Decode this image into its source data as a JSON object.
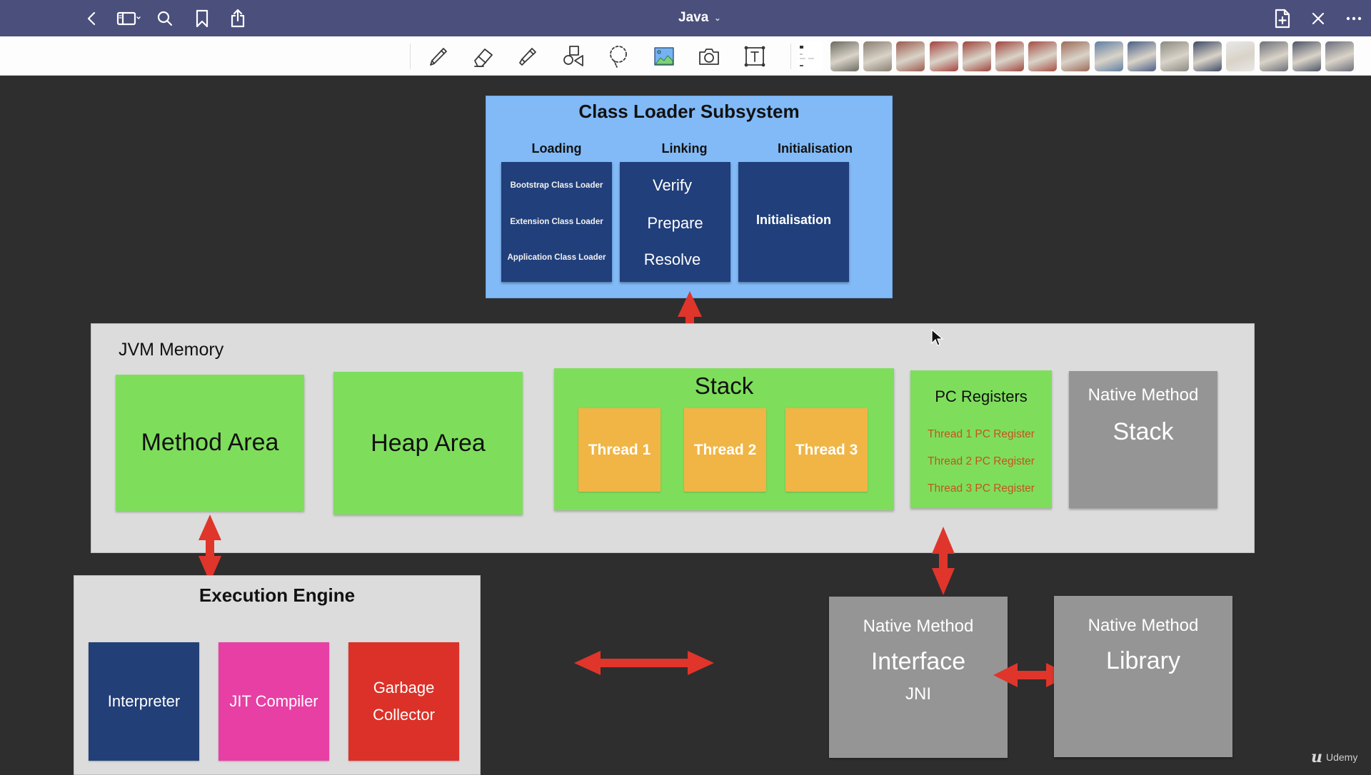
{
  "titlebar": {
    "title": "Java",
    "title_chevron": "⌄",
    "left_icons": [
      "back-icon",
      "sidebar-toggle-icon",
      "search-icon",
      "bookmark-icon",
      "share-icon"
    ],
    "right_icons": [
      "add-page-icon",
      "close-icon",
      "more-icon"
    ]
  },
  "toolbar": {
    "tools": [
      "pen-tool",
      "eraser-tool",
      "highlighter-tool",
      "shapes-tool",
      "lasso-tool",
      "image-tool",
      "camera-tool",
      "text-tool"
    ],
    "thumbnails_count": 16,
    "thumbnail_colors": [
      "#6b6a62",
      "#8a7f72",
      "#9b5a4e",
      "#a4423c",
      "#9e453d",
      "#a0463e",
      "#a54e44",
      "#9c6a58",
      "#5f7fa3",
      "#4a5f86",
      "#8b8a82",
      "#3e4a66",
      "#e8e8e8",
      "#6c6f78",
      "#4c5366",
      "#6b6e7c"
    ]
  },
  "diagram": {
    "class_loader": {
      "title": "Class Loader Subsystem",
      "columns": [
        {
          "label": "Loading",
          "items": [
            "Bootstrap Class Loader",
            "Extension Class Loader",
            "Application Class Loader"
          ]
        },
        {
          "label": "Linking",
          "items": [
            "Verify",
            "Prepare",
            "Resolve"
          ]
        },
        {
          "label": "Initialisation",
          "items": [
            "Initialisation"
          ]
        }
      ]
    },
    "jvm_memory": {
      "label": "JVM Memory",
      "method_area": "Method Area",
      "heap_area": "Heap Area",
      "stack": {
        "title": "Stack",
        "threads": [
          "Thread 1",
          "Thread 2",
          "Thread 3"
        ]
      },
      "pc_registers": {
        "title": "PC Registers",
        "items": [
          "Thread 1 PC Register",
          "Thread 2 PC Register",
          "Thread 3 PC Register"
        ]
      },
      "native_method_stack": {
        "line1": "Native Method",
        "line2": "Stack"
      }
    },
    "execution_engine": {
      "title": "Execution Engine",
      "components": [
        {
          "label": "Interpreter",
          "color": "#233f78"
        },
        {
          "label": "JIT Compiler",
          "color": "#e73fa4"
        },
        {
          "label_line1": "Garbage",
          "label_line2": "Collector",
          "color": "#dc3128"
        }
      ]
    },
    "native_interface": {
      "line1": "Native Method",
      "line2": "Interface",
      "line3": "JNI"
    },
    "native_library": {
      "line1": "Native Method",
      "line2": "Library"
    },
    "colors": {
      "titlebar": "#4b4f7c",
      "canvas": "#2e2e2e",
      "class_loader_bg": "#81baf7",
      "class_loader_panel": "#213f7a",
      "memory_green": "#7ede5c",
      "thread_orange": "#f0b545",
      "pc_register_text": "#c6531e",
      "native_grey": "#959595",
      "container_grey": "#dcdcdc",
      "arrow_red": "#e0352b"
    }
  },
  "watermark": {
    "brand": "Udemy"
  }
}
